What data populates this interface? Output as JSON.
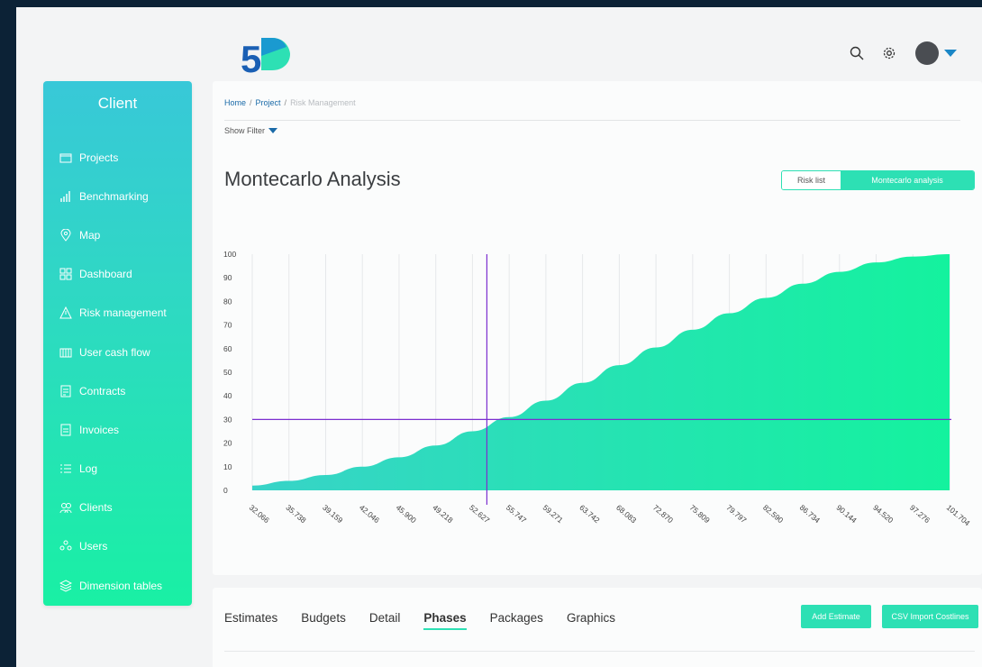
{
  "brand": {
    "logo_text": "5D",
    "colors": {
      "accent": "#2de0b4",
      "link": "#1a6aa8",
      "cursor_line": "#7c2fd0"
    }
  },
  "header": {
    "icons": [
      "search-icon",
      "gear-icon",
      "avatar",
      "chevron-down-icon"
    ]
  },
  "sidebar": {
    "title": "Client",
    "items": [
      {
        "label": "Projects",
        "icon": "projects-icon"
      },
      {
        "label": "Benchmarking",
        "icon": "bar-chart-icon"
      },
      {
        "label": "Map",
        "icon": "map-pin-icon"
      },
      {
        "label": "Dashboard",
        "icon": "dashboard-icon"
      },
      {
        "label": "Risk management",
        "icon": "warning-icon"
      },
      {
        "label": "User cash flow",
        "icon": "cash-flow-icon"
      },
      {
        "label": "Contracts",
        "icon": "contract-icon"
      },
      {
        "label": "Invoices",
        "icon": "invoice-icon"
      },
      {
        "label": "Log",
        "icon": "log-icon"
      },
      {
        "label": "Clients",
        "icon": "clients-icon"
      },
      {
        "label": "Users",
        "icon": "users-icon"
      },
      {
        "label": "Dimension tables",
        "icon": "layers-icon"
      }
    ]
  },
  "breadcrumb": {
    "home": "Home",
    "sep1": "/",
    "project": "Project",
    "sep2": "/",
    "current": "Risk Management"
  },
  "filter": {
    "label": "Show Filter"
  },
  "page": {
    "title": "Montecarlo Analysis"
  },
  "toggle": {
    "risk_list": "Risk list",
    "montecarlo": "Montecarlo analysis"
  },
  "chart_data": {
    "type": "area",
    "title": "",
    "xlabel": "",
    "ylabel": "",
    "ylim": [
      0,
      100
    ],
    "yticks": [
      0,
      10,
      20,
      30,
      40,
      50,
      60,
      70,
      80,
      90,
      100
    ],
    "x": [
      "32.066",
      "35.738",
      "39.159",
      "42.046",
      "45.900",
      "49.218",
      "52.627",
      "55.747",
      "59.271",
      "63.742",
      "68.083",
      "72.870",
      "75.809",
      "79.797",
      "82.590",
      "86.734",
      "90.144",
      "94.520",
      "97.276",
      "101.704"
    ],
    "series": [
      {
        "values": [
          2,
          4,
          6.5,
          10,
          14,
          19,
          25,
          31,
          38,
          45.5,
          53,
          60.5,
          68,
          75,
          81.5,
          87.5,
          92.5,
          96.5,
          99,
          100
        ]
      }
    ],
    "crosshair": {
      "x": "52.627",
      "y": 30
    },
    "grid": "vertical"
  },
  "bottom": {
    "tabs": [
      "Estimates",
      "Budgets",
      "Detail",
      "Phases",
      "Packages",
      "Graphics"
    ],
    "active_tab": "Phases",
    "add_estimate": "Add Estimate",
    "csv_import": "CSV Import Costlines"
  }
}
